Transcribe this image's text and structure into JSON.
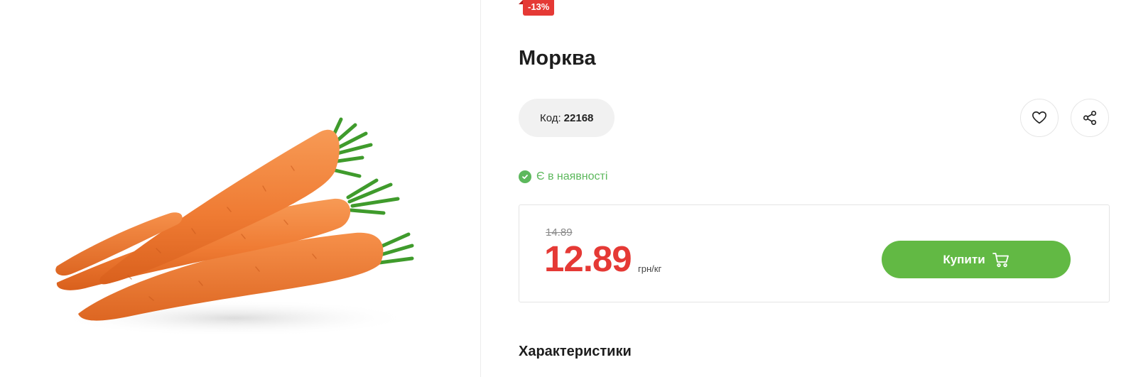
{
  "product": {
    "discount_badge": "-13%",
    "title": "Морква",
    "code_label": "Код:",
    "code_value": "22168",
    "stock_status": "Є в наявності",
    "old_price": "14.89",
    "price": "12.89",
    "unit": "грн/кг",
    "buy_label": "Купити",
    "characteristics_heading": "Характеристики"
  },
  "icons": {
    "favorite": "heart-icon",
    "share": "share-icon",
    "stock": "check-circle-icon",
    "cart": "cart-icon"
  },
  "colors": {
    "accent_green": "#62b944",
    "price_red": "#e53935",
    "stock_green": "#5cb85c"
  }
}
